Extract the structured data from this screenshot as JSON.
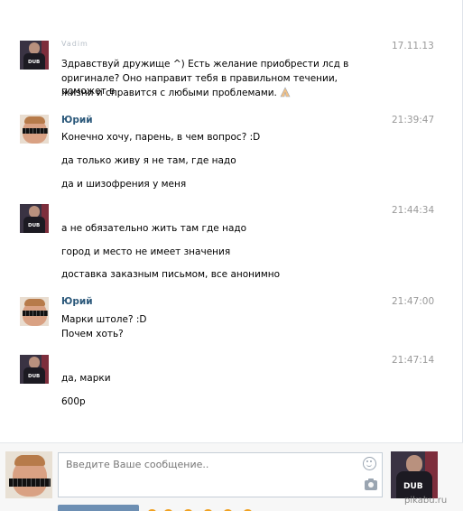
{
  "messages": [
    {
      "author": "Vadim",
      "time": "17.11.13",
      "avatar": "dub",
      "lines": [
        "Здравствуй дружище ^) Есть желание приобрести лсд в",
        "оригинале? Оно направит тебя в правильном течении, поможет в",
        "жизни и справится с любыми проблемами."
      ]
    },
    {
      "author": "Юрий",
      "time": "21:39:47",
      "avatar": "yuri",
      "lines": [
        "Конечно хочу, парень, в чем вопрос? :D",
        "да только живу я не там, где надо",
        "да и шизофрения у меня"
      ]
    },
    {
      "author": "",
      "time": "21:44:34",
      "avatar": "dub",
      "lines": [
        "а не обязательно жить там где надо",
        "город и место не имеет значения",
        "доставка заказным письмом, все анонимно"
      ]
    },
    {
      "author": "Юрий",
      "time": "21:47:00",
      "avatar": "yuri",
      "lines": [
        "Марки штоле? :D",
        "Почем хоть?"
      ]
    },
    {
      "author": "",
      "time": "21:47:14",
      "avatar": "dub",
      "lines": [
        "да, марки",
        "600р"
      ]
    }
  ],
  "composer": {
    "placeholder": "Введите Ваше сообщение.."
  },
  "watermark": "pikabu.ru",
  "colors": {
    "name": "#2b587a",
    "time": "#999999",
    "accent": "#6d8fb3"
  }
}
